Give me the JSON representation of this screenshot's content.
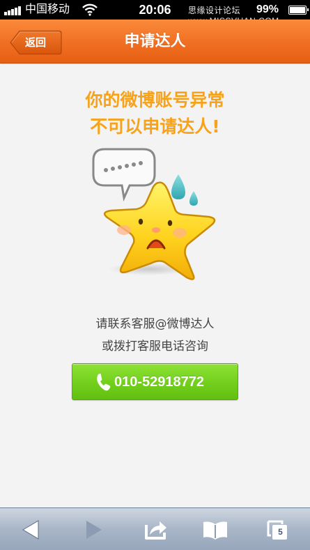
{
  "status_bar": {
    "carrier": "中国移动",
    "time": "20:06",
    "watermark": "思缘设计论坛 www.MISSVUAN.COM",
    "battery": "99%"
  },
  "nav": {
    "back_label": "返回",
    "title": "申请达人"
  },
  "main": {
    "headline_line1": "你的微博账号异常",
    "headline_line2": "不可以申请达人!",
    "info_line1": "请联系客服@微博达人",
    "info_line2": "或拨打客服电话咨询",
    "phone": "010-52918772"
  },
  "toolbar": {
    "tabs_count": "5"
  },
  "colors": {
    "nav_orange": "#f06f22",
    "headline_orange": "#f7a21b",
    "button_green": "#72cf1c"
  },
  "icons": [
    "signal-icon",
    "wifi-icon",
    "battery-icon",
    "back-arrow-icon",
    "phone-icon",
    "back-icon",
    "forward-icon",
    "share-icon",
    "bookmarks-icon",
    "tabs-icon"
  ]
}
